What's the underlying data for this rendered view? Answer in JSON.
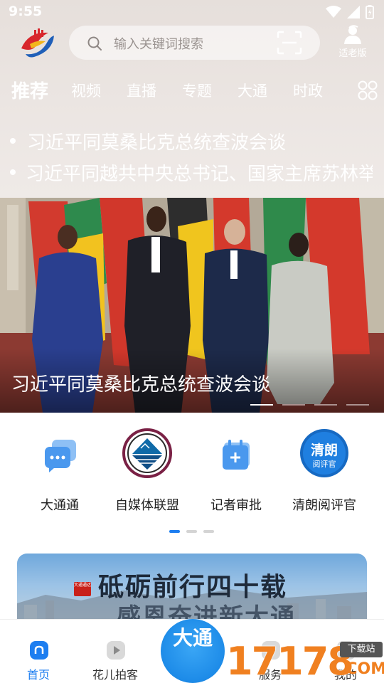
{
  "status_bar": {
    "time": "9:55"
  },
  "header": {
    "search_placeholder": "输入关键词搜索",
    "elder_mode_label": "适老版"
  },
  "nav_tabs": [
    {
      "label": "推荐",
      "active": true
    },
    {
      "label": "视频",
      "active": false
    },
    {
      "label": "直播",
      "active": false
    },
    {
      "label": "专题",
      "active": false
    },
    {
      "label": "大通",
      "active": false
    },
    {
      "label": "时政",
      "active": false
    }
  ],
  "ticker": [
    "习近平同莫桑比克总统查波会谈",
    "习近平同越共中央总书记、国家主席苏林举行会谈"
  ],
  "banner": {
    "caption": "习近平同莫桑比克总统查波会谈",
    "slide_count": 4,
    "active_slide": 1
  },
  "quick_links": [
    {
      "label": "大通通",
      "icon": "chat-bubble-icon"
    },
    {
      "label": "自媒体联盟",
      "icon": "media-alliance-logo"
    },
    {
      "label": "记者审批",
      "icon": "calendar-add-icon"
    },
    {
      "label": "清朗阅评官",
      "icon": "qinglang-reviewer-logo",
      "logo_text": [
        "清朗",
        "阅评官"
      ]
    }
  ],
  "quick_pager": {
    "pages": 3,
    "active": 1
  },
  "promo": {
    "badge": "大通通达",
    "title": "砥砺前行四十载",
    "subtitle": "感恩奋进新大通"
  },
  "tabbar": {
    "items": [
      {
        "label": "首页",
        "active": true,
        "icon": "home-icon"
      },
      {
        "label": "花儿拍客",
        "active": false,
        "icon": "video-play-icon"
      },
      {
        "label": "服务",
        "active": false,
        "icon": "service-icon"
      },
      {
        "label": "我的",
        "active": false,
        "icon": "profile-icon"
      }
    ],
    "center_label": "大通"
  },
  "watermark": {
    "digits": "17178",
    "badge": "下载站",
    "suffix": ".COM"
  },
  "colors": {
    "accent": "#1d7ef0",
    "header_bg": "#e6dfdb",
    "watermark": "#f08020"
  }
}
